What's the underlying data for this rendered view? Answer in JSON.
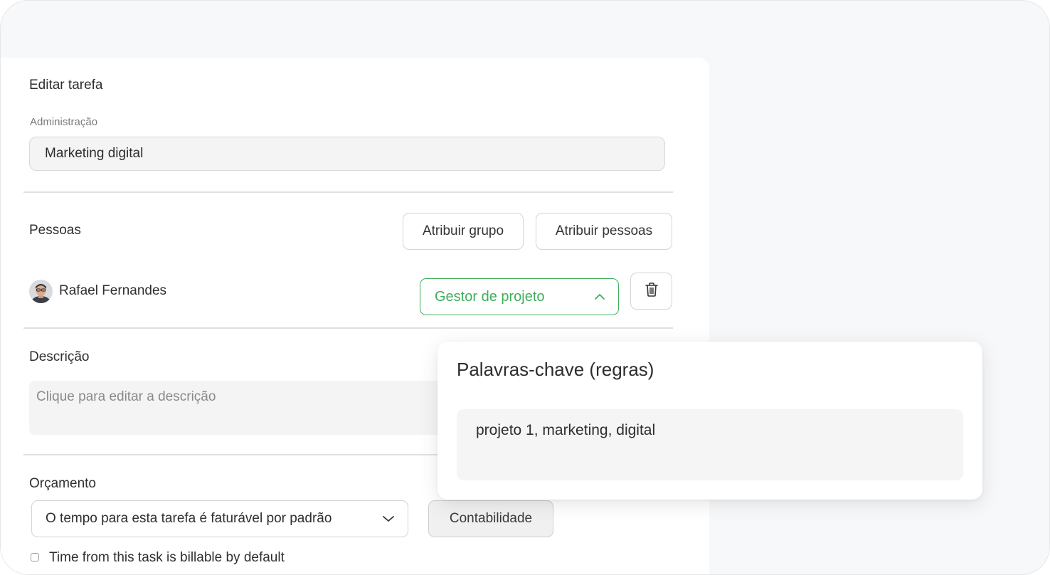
{
  "form": {
    "title": "Editar tarefa",
    "name_field": {
      "label": "Administração",
      "value": "Marketing digital"
    },
    "people": {
      "label": "Pessoas",
      "assign_group_label": "Atribuir grupo",
      "assign_people_label": "Atribuir pessoas",
      "members": [
        {
          "name": "Rafael Fernandes",
          "role": "Gestor de projeto"
        }
      ]
    },
    "description": {
      "label": "Descrição",
      "placeholder": "Clique para editar a descrição"
    },
    "budget": {
      "label": "Orçamento",
      "billing_select": "O tempo para esta tarefa é faturável por padrão",
      "accounting_label": "Contabilidade",
      "checkbox_label": "Time from this task is billable by default"
    }
  },
  "keywords_popup": {
    "title": "Palavras-chave (regras)",
    "value": "projeto 1, marketing, digital"
  },
  "colors": {
    "accent": "#3fae5a",
    "field_bg": "#f4f4f4",
    "border": "#d4d4d4"
  },
  "icons": {
    "role_chevron": "chevron-up-icon",
    "budget_chevron": "chevron-down-icon",
    "delete": "trash-icon"
  }
}
